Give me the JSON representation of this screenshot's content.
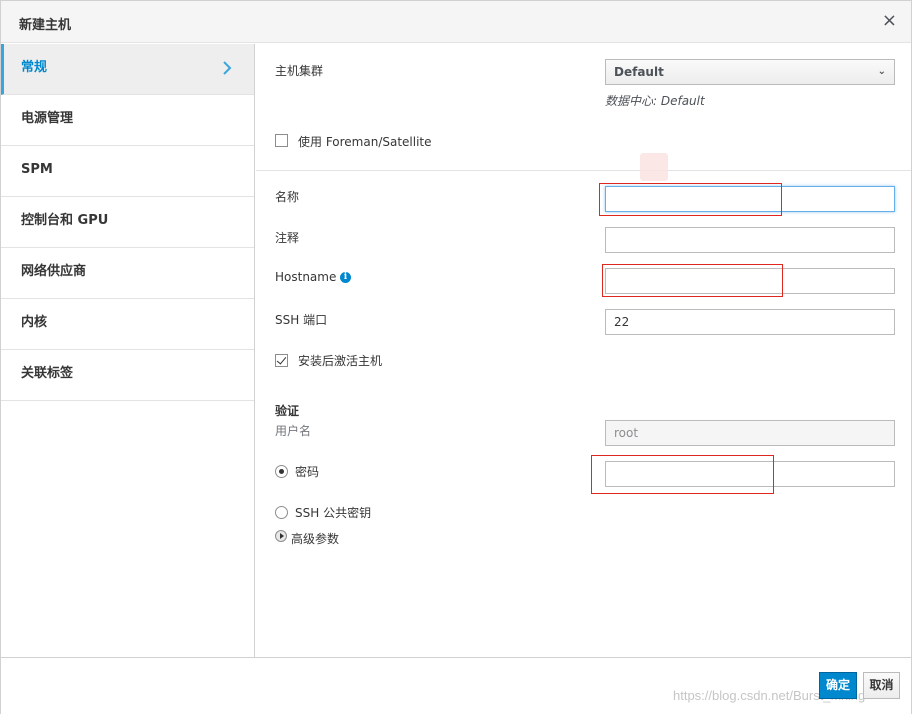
{
  "dialog": {
    "title": "新建主机",
    "close_glyph": "×"
  },
  "sidebar": {
    "items": [
      {
        "label": "常规",
        "active": true
      },
      {
        "label": "电源管理"
      },
      {
        "label": "SPM"
      },
      {
        "label": "控制台和 GPU"
      },
      {
        "label": "网络供应商"
      },
      {
        "label": "内核"
      },
      {
        "label": "关联标签"
      }
    ]
  },
  "form": {
    "cluster_label": "主机集群",
    "cluster_value": "Default",
    "datacenter_note": "数据中心: Default",
    "foreman_label": "使用 Foreman/Satellite",
    "name_label": "名称",
    "name_value": "",
    "comment_label": "注释",
    "comment_value": "",
    "hostname_label": "Hostname",
    "hostname_value": "",
    "ssh_port_label": "SSH 端口",
    "ssh_port_value": "22",
    "activate_label": "安装后激活主机",
    "auth_heading": "验证",
    "username_label": "用户名",
    "username_value": "root",
    "password_label": "密码",
    "password_value": "",
    "ssh_key_label": "SSH 公共密钥",
    "advanced_label": "高级参数"
  },
  "footer": {
    "ok_label": "确定",
    "cancel_label": "取消",
    "watermark": "https://blog.csdn.net/Burst_Mxing"
  },
  "colors": {
    "accent": "#0088ce",
    "highlight": "#e0271d"
  }
}
